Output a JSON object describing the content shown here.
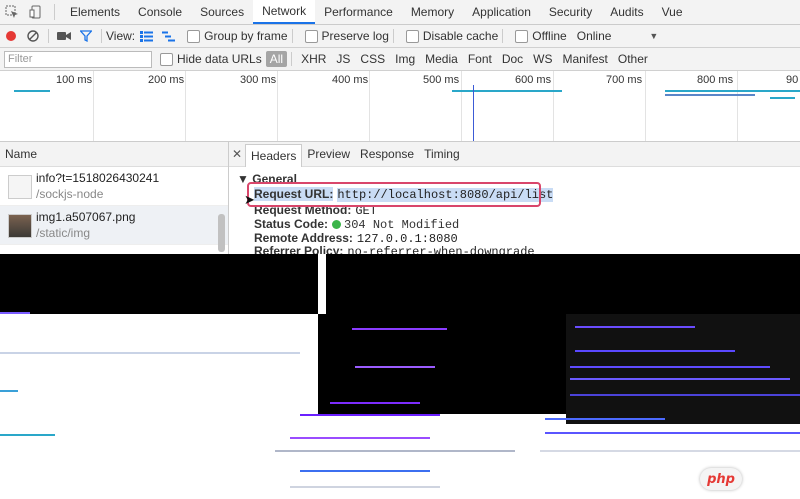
{
  "tabs": [
    "Elements",
    "Console",
    "Sources",
    "Network",
    "Performance",
    "Memory",
    "Application",
    "Security",
    "Audits",
    "Vue"
  ],
  "active_tab": "Network",
  "toolbar": {
    "view_label": "View:",
    "group_by_frame": "Group by frame",
    "preserve_log": "Preserve log",
    "disable_cache": "Disable cache",
    "offline": "Offline",
    "throttle": "Online"
  },
  "filter": {
    "placeholder": "Filter",
    "hide_data_urls": "Hide data URLs",
    "types": [
      "All",
      "XHR",
      "JS",
      "CSS",
      "Img",
      "Media",
      "Font",
      "Doc",
      "WS",
      "Manifest",
      "Other"
    ]
  },
  "timeline": {
    "ticks": [
      "100 ms",
      "200 ms",
      "300 ms",
      "400 ms",
      "500 ms",
      "600 ms",
      "700 ms",
      "800 ms",
      "90"
    ]
  },
  "requests": {
    "column": "Name",
    "items": [
      {
        "name": "info?t=1518026430241",
        "path": "/sockjs-node"
      },
      {
        "name": "img1.a507067.png",
        "path": "/static/img"
      }
    ]
  },
  "detail": {
    "tabs": [
      "Headers",
      "Preview",
      "Response",
      "Timing"
    ],
    "active": "Headers",
    "section": "General",
    "rows": [
      {
        "key": "Request URL:",
        "value": "http://localhost:8080/api/list"
      },
      {
        "key": "Request Method:",
        "value": "GET"
      },
      {
        "key": "Status Code:",
        "value": "304 Not Modified"
      },
      {
        "key": "Remote Address:",
        "value": "127.0.0.1:8080"
      },
      {
        "key": "Referrer Policy:",
        "value": "no-referrer-when-downgrade"
      }
    ]
  },
  "watermark": "php",
  "colors": {
    "accent": "#1a73e8",
    "record": "#e53935",
    "highlight": "#d9466b",
    "status_ok": "#3bb54a"
  }
}
